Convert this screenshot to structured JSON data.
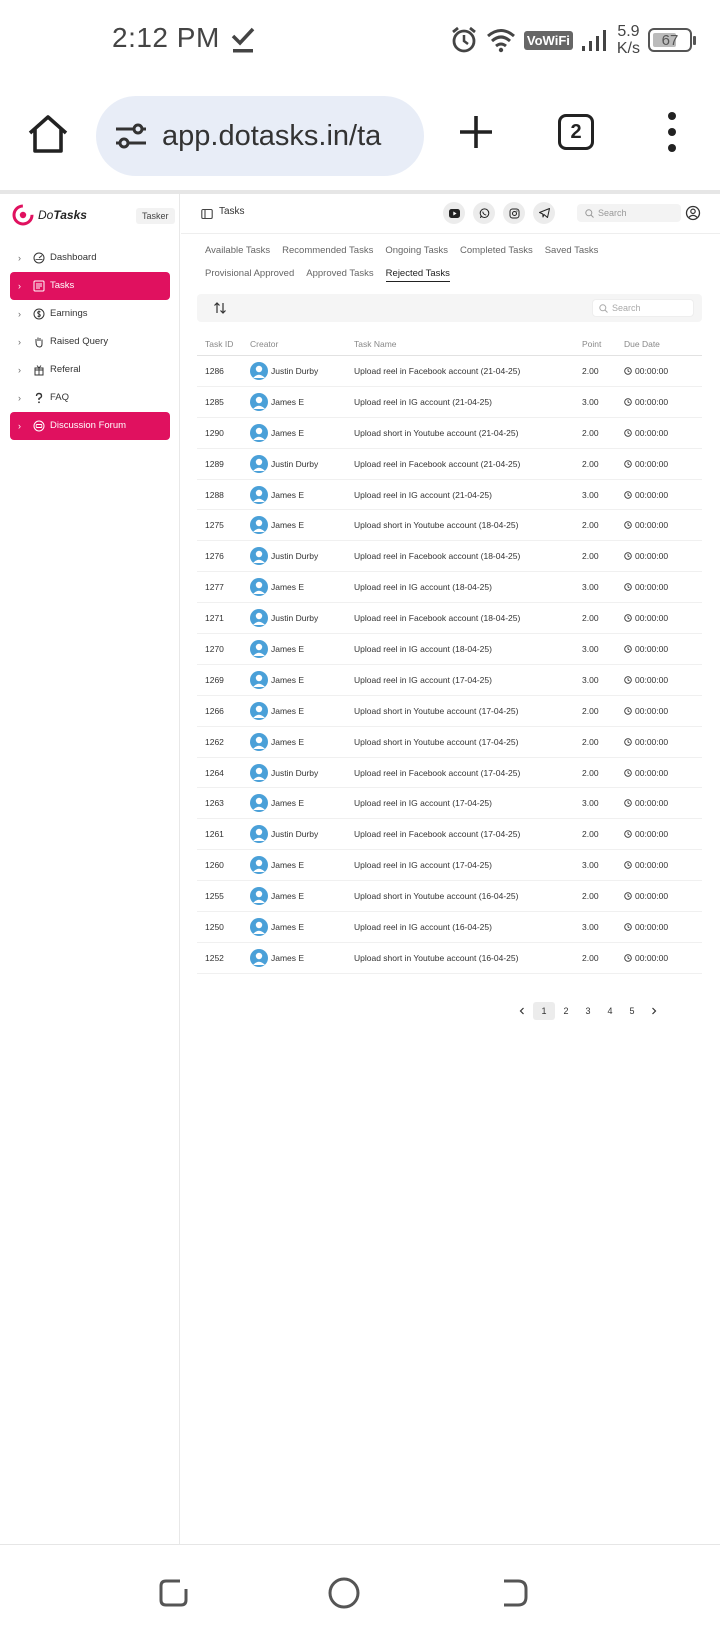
{
  "status_bar": {
    "time": "2:12 PM",
    "vowifi": "VoWiFi",
    "speed_value": "5.9",
    "speed_unit": "K/s",
    "battery": "67",
    "battery_level": 0.67
  },
  "browser": {
    "url": "app.dotasks.in/ta",
    "tab_count": "2"
  },
  "sidebar": {
    "brand_plain": "Do",
    "brand_bold": "Tasks",
    "role_badge": "Tasker",
    "items": [
      {
        "label": "Dashboard",
        "icon": "dashboard-icon",
        "active": false
      },
      {
        "label": "Tasks",
        "icon": "tasks-icon",
        "active": true
      },
      {
        "label": "Earnings",
        "icon": "earnings-icon",
        "active": false
      },
      {
        "label": "Raised Query",
        "icon": "hand-icon",
        "active": false
      },
      {
        "label": "Referal",
        "icon": "referral-icon",
        "active": false
      },
      {
        "label": "FAQ",
        "icon": "question-icon",
        "active": false
      },
      {
        "label": "Discussion Forum",
        "icon": "forum-icon",
        "active": true
      }
    ]
  },
  "header": {
    "title": "Tasks",
    "search_placeholder": "Search"
  },
  "tabs": {
    "row1": [
      "Available Tasks",
      "Recommended Tasks",
      "Ongoing Tasks",
      "Completed Tasks",
      "Saved Tasks"
    ],
    "row2": [
      "Provisional Approved",
      "Approved Tasks",
      "Rejected Tasks"
    ],
    "active": "Rejected Tasks"
  },
  "table": {
    "search_placeholder": "Search",
    "columns": [
      "Task ID",
      "Creator",
      "Task Name",
      "Point",
      "Due Date"
    ],
    "rows": [
      [
        "1286",
        "Justin Durby",
        "Upload reel in Facebook account (21-04-25)",
        "2.00",
        "00:00:00"
      ],
      [
        "1285",
        "James E",
        "Upload reel in IG account (21-04-25)",
        "3.00",
        "00:00:00"
      ],
      [
        "1290",
        "James E",
        "Upload short in Youtube account (21-04-25)",
        "2.00",
        "00:00:00"
      ],
      [
        "1289",
        "Justin Durby",
        "Upload reel in Facebook account (21-04-25)",
        "2.00",
        "00:00:00"
      ],
      [
        "1288",
        "James E",
        "Upload reel in IG account (21-04-25)",
        "3.00",
        "00:00:00"
      ],
      [
        "1275",
        "James E",
        "Upload short in Youtube account (18-04-25)",
        "2.00",
        "00:00:00"
      ],
      [
        "1276",
        "Justin Durby",
        "Upload reel in Facebook account (18-04-25)",
        "2.00",
        "00:00:00"
      ],
      [
        "1277",
        "James E",
        "Upload reel in IG account (18-04-25)",
        "3.00",
        "00:00:00"
      ],
      [
        "1271",
        "Justin Durby",
        "Upload reel in Facebook account (18-04-25)",
        "2.00",
        "00:00:00"
      ],
      [
        "1270",
        "James E",
        "Upload reel in IG account (18-04-25)",
        "3.00",
        "00:00:00"
      ],
      [
        "1269",
        "James E",
        "Upload reel in IG account (17-04-25)",
        "3.00",
        "00:00:00"
      ],
      [
        "1266",
        "James E",
        "Upload short in Youtube account (17-04-25)",
        "2.00",
        "00:00:00"
      ],
      [
        "1262",
        "James E",
        "Upload short in Youtube account (17-04-25)",
        "2.00",
        "00:00:00"
      ],
      [
        "1264",
        "Justin Durby",
        "Upload reel in Facebook account (17-04-25)",
        "2.00",
        "00:00:00"
      ],
      [
        "1263",
        "James E",
        "Upload reel in IG account (17-04-25)",
        "3.00",
        "00:00:00"
      ],
      [
        "1261",
        "Justin Durby",
        "Upload reel in Facebook account (17-04-25)",
        "2.00",
        "00:00:00"
      ],
      [
        "1260",
        "James E",
        "Upload reel in IG account (17-04-25)",
        "3.00",
        "00:00:00"
      ],
      [
        "1255",
        "James E",
        "Upload short in Youtube account (16-04-25)",
        "2.00",
        "00:00:00"
      ],
      [
        "1250",
        "James E",
        "Upload reel in IG account (16-04-25)",
        "3.00",
        "00:00:00"
      ],
      [
        "1252",
        "James E",
        "Upload short in Youtube account (16-04-25)",
        "2.00",
        "00:00:00"
      ]
    ]
  },
  "pagination": {
    "pages": [
      "1",
      "2",
      "3",
      "4",
      "5"
    ],
    "current": "1"
  },
  "colors": {
    "accent": "#e0115f",
    "avatar": "#4aa0d8"
  }
}
